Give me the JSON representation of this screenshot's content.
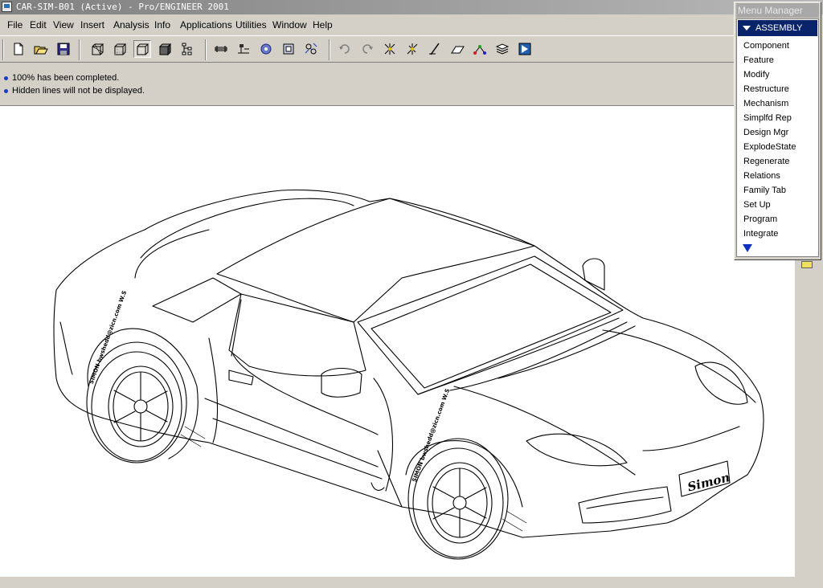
{
  "window": {
    "title": "CAR-SIM-B01 (Active) - Pro/ENGINEER 2001"
  },
  "menubar": {
    "items": [
      "File",
      "Edit",
      "View",
      "Insert",
      "Analysis",
      "Info",
      "Applications",
      "Utilities",
      "Window",
      "Help"
    ]
  },
  "toolbar": {
    "buttons": [
      "new-file-icon",
      "open-file-icon",
      "save-icon",
      "wireframe-icon",
      "hidden-line-icon",
      "no-hidden-icon",
      "shading-icon",
      "model-tree-icon",
      "datum-planes-icon",
      "datum-axes-icon",
      "datum-points-icon",
      "coordinate-systems-icon",
      "spin-center-icon",
      "undo-icon",
      "redo-icon",
      "sketch-tool-icon",
      "edit-tool-icon",
      "axis-tool-icon",
      "plane-tool-icon",
      "point-tool-icon",
      "layers-icon",
      "view-manager-icon"
    ]
  },
  "messages": [
    "100% has been completed.",
    "Hidden lines will not be displayed."
  ],
  "menu_manager": {
    "title": "Menu Manager",
    "header": "ASSEMBLY",
    "items": [
      "Component",
      "Feature",
      "Modify",
      "Restructure",
      "Mechanism",
      "Simplfd Rep",
      "Design Mgr",
      "ExplodeState",
      "Regenerate",
      "Relations",
      "Family Tab",
      "Set Up",
      "Program",
      "Integrate"
    ]
  },
  "viewport": {
    "plate_text": "Simon",
    "tire_text": "SIMON bwshedd@zicn.com W.S"
  },
  "colors": {
    "accent": "#0a246a",
    "title_bg": "#808080",
    "message_dot": "#1a3cc0",
    "toolbar_bg": "#d4d0c8"
  }
}
